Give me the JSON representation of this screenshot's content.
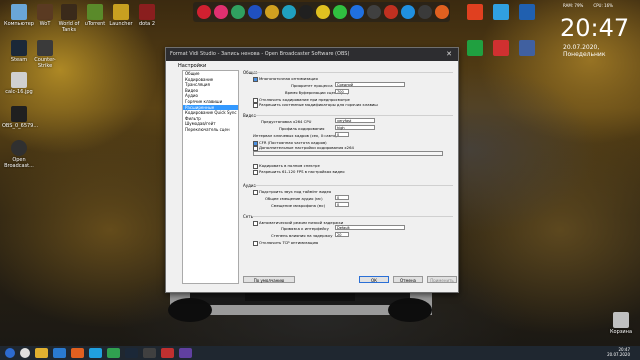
{
  "desktop": {
    "icons_left": [
      {
        "label": "Компьютер",
        "color": "#6aa6d8"
      },
      {
        "label": "WoT",
        "color": "#5a3a22"
      },
      {
        "label": "World of Tanks",
        "color": "#3a2a1a"
      },
      {
        "label": "uTorrent",
        "color": "#5a8a2a"
      },
      {
        "label": "Launcher",
        "color": "#c8a020"
      },
      {
        "label": "dota 2",
        "color": "#8a1e1e"
      }
    ],
    "icons_col": [
      {
        "label": "Steam",
        "color": "#1b2838"
      },
      {
        "label": "Counter-Strike",
        "color": "#3a3a3a"
      },
      {
        "label": "calc-16.jpg",
        "color": "#d0d0d0"
      },
      {
        "label": "OBS_0_6579...",
        "color": "#202020"
      },
      {
        "label": "Open Broadcast...",
        "color": "#303030"
      }
    ],
    "icons_right": [
      {
        "label": "",
        "color": "#e04020"
      },
      {
        "label": "",
        "color": "#30a0e0"
      },
      {
        "label": "",
        "color": "#2060b0"
      },
      {
        "label": "",
        "color": "#20a040"
      },
      {
        "label": "",
        "color": "#d03030"
      },
      {
        "label": "",
        "color": "#4060a0"
      }
    ],
    "recycle_label": "Корзина"
  },
  "widgets": {
    "clock": "20:47",
    "date": "20.07.2020, Понедельник",
    "ram": "RAM: 79%",
    "cpu": "CPU: 16%"
  },
  "window": {
    "title": "Format Vidi Studio - Запись ненова - Open Broadcaster Software (OBS)",
    "dialog_title": "Настройки",
    "nav": [
      "Общие",
      "Кодирование",
      "Трансляция",
      "Видео",
      "Аудио",
      "Горячие клавиши",
      "Расширенные",
      "Кодирование Quick Sync",
      "Фильтр",
      "Шумодав/гейт",
      "Переключатель сцен"
    ],
    "nav_selected": 6,
    "sections": {
      "general": "Общие",
      "video": "Видео",
      "audio": "Аудио",
      "network": "Сеть"
    },
    "general": {
      "multithread": "Многопоточная оптимизация",
      "priority_label": "Приоритет процесса",
      "priority_value": "Средний",
      "buffer_label": "Время буферизации сцены (мс)",
      "buffer_value": "700",
      "disable_preview": "Отключить кодирование при предпросмотре",
      "allow_dedicated": "Разрешить системные модификаторы для горячих клавиш"
    },
    "video": {
      "preset_label": "Предустановка x264 CPU",
      "preset_value": "veryfast",
      "profile_label": "Профиль кодирования",
      "profile_value": "high",
      "keyframe_label": "Интервал ключевых кадров (сек, 0=авто)",
      "keyframe_value": "0",
      "cfr": "CFR (Постоянная частота кадров)",
      "custom_x264": "Дополнительные настройки кодирования x264",
      "full_color": "Кодировать в полном спектре",
      "allow_120": "Разрешить 61-120 FPS в настройках видео"
    },
    "audio": {
      "sync_timestamps": "Подстроить звук под таймінг видео",
      "offset_label": "Общее смещение аудио (мс)",
      "offset_value": "0",
      "mic_offset_label": "Смещение микрофона (мс)",
      "mic_offset_value": "0"
    },
    "network": {
      "auto_lowlatency": "Автоматический режим низкой задержки",
      "bind_label": "Привязка к интерфейсу",
      "bind_value": "Default",
      "latency_label": "Степень влияния на задержку",
      "latency_value": "20",
      "disable_tcp": "Отключить TCP оптимизацию"
    },
    "buttons": {
      "defaults": "По умолчанию",
      "ok": "ОК",
      "cancel": "Отмена",
      "apply": "Применить"
    }
  },
  "taskbar": {
    "time": "20:47",
    "date": "20.07.2020"
  }
}
